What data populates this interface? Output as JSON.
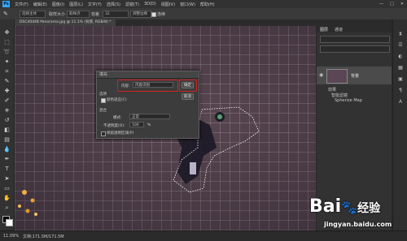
{
  "menubar": {
    "logo": "Ps",
    "items": [
      "文件(F)",
      "编辑(E)",
      "图像(I)",
      "图层(L)",
      "文字(Y)",
      "选择(S)",
      "滤镜(T)",
      "3D(D)",
      "视图(V)",
      "窗口(W)",
      "帮助(H)"
    ],
    "window_controls": [
      "—",
      "□",
      "✕"
    ]
  },
  "optionsbar": {
    "mode_label": "选择主体",
    "sample_label": "取样大小",
    "sample_value": "取样点",
    "tolerance_label": "容差",
    "tolerance_value": "32",
    "field3": "调整边缘",
    "checkbox_label": "连续"
  },
  "tab": {
    "title": "DSC40448 Panorama.jpg @ 11.1% (背景, RGB/8) *"
  },
  "dialog": {
    "title": "填充",
    "content_label": "内容:",
    "content_value": "内容识别",
    "ok_label": "确定",
    "cancel_label": "取消",
    "options_label": "选项",
    "color_adapt_label": "颜色适应(C)",
    "blending_label": "混合",
    "mode_label": "模式:",
    "mode_value": "正常",
    "opacity_label": "不透明度(O):",
    "opacity_value": "100",
    "opacity_unit": "%",
    "preserve_label": "保留透明区域(P)"
  },
  "panels": {
    "tabs": [
      "图层",
      "通道"
    ],
    "layer_name": "背景",
    "layer_sub1": "效果",
    "layer_sub2": "智能滤镜",
    "layer_sub3": "Spherize Map"
  },
  "statusbar": {
    "zoom": "11.09%",
    "doc": "文档:171.5M/171.5M"
  },
  "watermark": {
    "brand": "Bai",
    "brand2": "经验",
    "url": "jingyan.baidu.com"
  },
  "colors": {
    "accent": "#31a8ff",
    "highlight_box": "#d42020",
    "bg": "#282828"
  }
}
